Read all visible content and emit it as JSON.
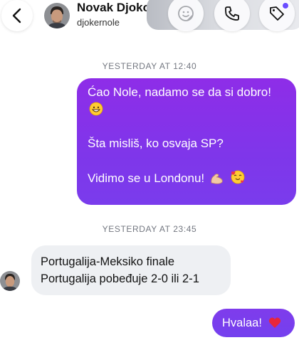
{
  "header": {
    "contact_name": "Novak Djoko...",
    "contact_handle": "djokernole",
    "back_icon": "chevron-left-icon",
    "actions": [
      {
        "icon": "sticker-icon"
      },
      {
        "icon": "phone-icon"
      },
      {
        "icon": "tag-icon"
      }
    ]
  },
  "messages": {
    "timestamp_1": "YESTERDAY AT 12:40",
    "outgoing_1": {
      "line_1": "Ćao Nole, nadamo se da si dobro!",
      "line_2": "Šta misliš, ko osvaja SP?",
      "line_3": "Vidimo se u Londonu!",
      "emojis": [
        "grinning-face",
        "flexed-biceps",
        "smiling-face-with-hearts"
      ]
    },
    "timestamp_2": "YESTERDAY AT 23:45",
    "incoming_1": {
      "line_1": "Portugalija-Meksiko finale",
      "line_2": "Portugalija pobeđuje 2-0 ili 2-1"
    },
    "outgoing_2": {
      "text": "Hvalaa!",
      "emoji": "red-heart"
    }
  },
  "colors": {
    "outgoing_bubble": "#8a30ea",
    "incoming_bubble": "#eef0f3",
    "timestamp": "#737780",
    "accent_dot": "#6a4dff"
  }
}
